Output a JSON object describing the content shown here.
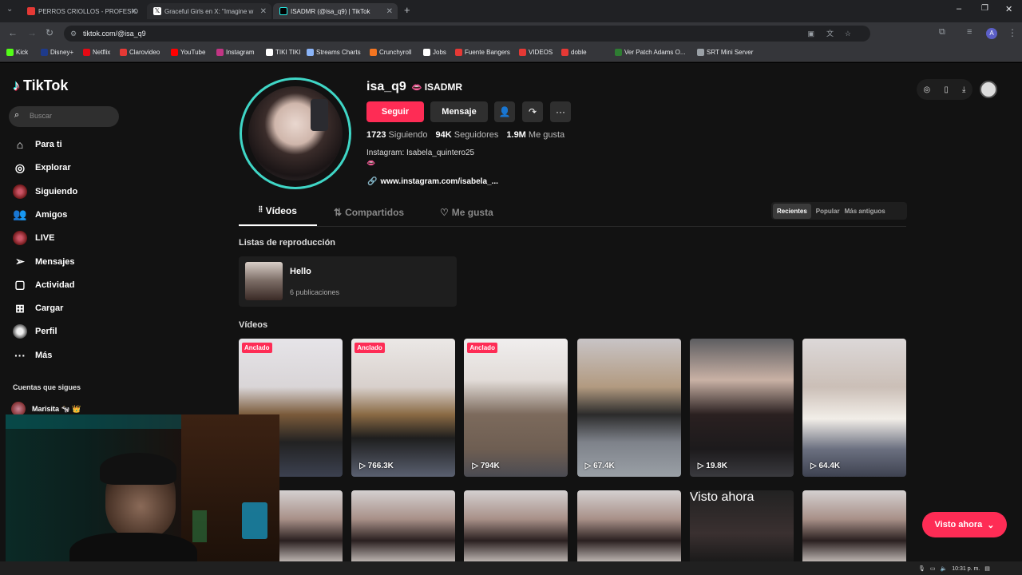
{
  "browser": {
    "tabs": [
      {
        "title": "PERROS CRIOLLOS - PROFESIO",
        "color": "#e53935"
      },
      {
        "title": "Graceful Girls en X: \"Imagine w",
        "color": "#ffffff"
      },
      {
        "title": "ISADMR (@isa_q9) | TikTok",
        "color": "#25f4ee"
      }
    ],
    "url": "tiktok.com/@isa_q9",
    "bookmarks": [
      {
        "label": "Kick",
        "color": "#53fc18"
      },
      {
        "label": "Disney+",
        "color": "#1e3a8a"
      },
      {
        "label": "Netflix",
        "color": "#e50914"
      },
      {
        "label": "Clarovideo",
        "color": "#e53935"
      },
      {
        "label": "YouTube",
        "color": "#ff0000"
      },
      {
        "label": "Instagram",
        "color": "#c13584"
      },
      {
        "label": "TIKI TIKI",
        "color": "#ffffff"
      },
      {
        "label": "Streams Charts",
        "color": "#8ab4f8"
      },
      {
        "label": "Crunchyroll",
        "color": "#f47521"
      },
      {
        "label": "Jobs",
        "color": "#ffffff"
      },
      {
        "label": "Fuente Bangers",
        "color": "#e53935"
      },
      {
        "label": "VIDEOS",
        "color": "#e53935"
      },
      {
        "label": "doble",
        "color": "#e53935"
      },
      {
        "label": "Ver Patch Adams O...",
        "color": "#2e7d32"
      },
      {
        "label": "SRT Mini Server",
        "color": "#9aa0a6"
      }
    ]
  },
  "sidebar": {
    "logo": "TikTok",
    "search_placeholder": "Buscar",
    "items": [
      {
        "label": "Para ti",
        "icon": "home-icon"
      },
      {
        "label": "Explorar",
        "icon": "compass-icon"
      },
      {
        "label": "Siguiendo",
        "icon": "avatar-icon"
      },
      {
        "label": "Amigos",
        "icon": "friends-icon"
      },
      {
        "label": "LIVE",
        "icon": "live-icon"
      },
      {
        "label": "Mensajes",
        "icon": "send-icon"
      },
      {
        "label": "Actividad",
        "icon": "activity-icon"
      },
      {
        "label": "Cargar",
        "icon": "upload-icon"
      },
      {
        "label": "Perfil",
        "icon": "profile-icon"
      },
      {
        "label": "Más",
        "icon": "more-icon"
      }
    ],
    "following_title": "Cuentas que sigues",
    "following": [
      {
        "name": "Marisita 🐄 👑"
      }
    ]
  },
  "profile": {
    "username": "isa_q9",
    "nickname": "ISADMR",
    "follow_label": "Seguir",
    "message_label": "Mensaje",
    "stats": {
      "following_count": "1723",
      "following_label": "Siguiendo",
      "followers_count": "94K",
      "followers_label": "Seguidores",
      "likes_count": "1.9M",
      "likes_label": "Me gusta"
    },
    "bio": "Instagram: Isabela_quintero25",
    "link": "www.instagram.com/isabela_..."
  },
  "tabs": [
    {
      "label": "Vídeos"
    },
    {
      "label": "Compartidos"
    },
    {
      "label": "Me gusta"
    }
  ],
  "sort": [
    "Recientes",
    "Popular",
    "Más antiguos"
  ],
  "playlists_title": "Listas de reproducción",
  "playlist": {
    "name": "Hello",
    "count": "6 publicaciones"
  },
  "videos_title": "Vídeos",
  "videos": [
    {
      "pinned": "Anclado",
      "views": ""
    },
    {
      "pinned": "Anclado",
      "views": "766.3K"
    },
    {
      "pinned": "Anclado",
      "views": "794K"
    },
    {
      "pinned": "",
      "views": "67.4K"
    },
    {
      "pinned": "",
      "views": "19.8K"
    },
    {
      "pinned": "",
      "views": "64.4K"
    }
  ],
  "second_row_watched": "Visto ahora",
  "watch_now": "Visto ahora",
  "taskbar_time": "10:31 p. m.",
  "accent": "#fe2c55"
}
